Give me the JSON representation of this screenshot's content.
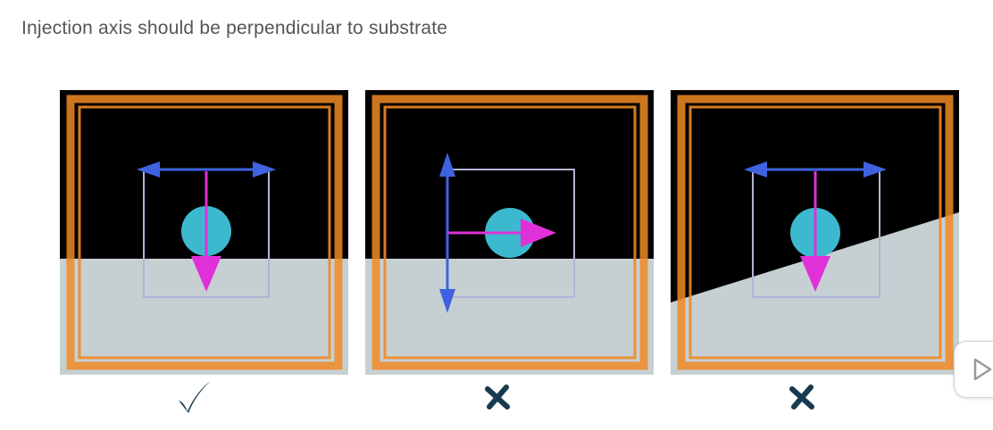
{
  "title": "Injection axis should be perpendicular to substrate",
  "colors": {
    "background_black": "#000000",
    "substrate": "#c6d0d3",
    "frame_orange": "#f08a24",
    "horizontal_axes_blue": "#3f63e0",
    "injection_axis_magenta": "#e030d8",
    "droplet_cyan": "#3cb9cf",
    "box_outline": "#b3b3d6",
    "mark_color": "#173a50"
  },
  "panels": [
    {
      "id": "correct",
      "mark": "check-icon",
      "verdict": "correct"
    },
    {
      "id": "wrong-axis",
      "mark": "cross-icon",
      "verdict": "incorrect"
    },
    {
      "id": "tilted-substrate",
      "mark": "cross-icon",
      "verdict": "incorrect"
    }
  ]
}
